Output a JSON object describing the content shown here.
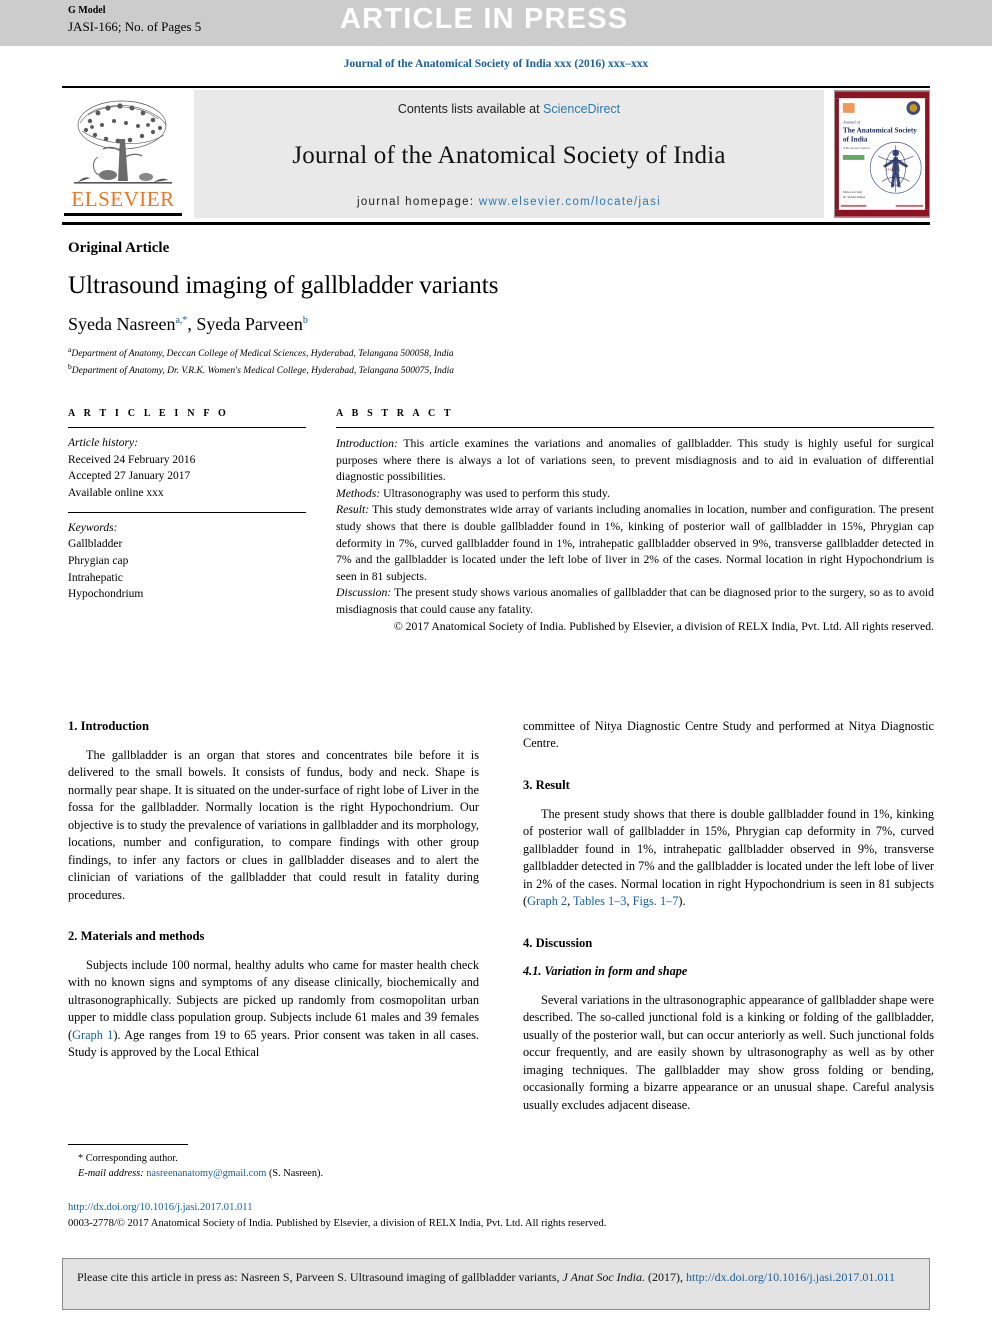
{
  "banner": {
    "press_text": "ARTICLE IN PRESS",
    "g_model": "G Model",
    "manuscript_id": "JASI-166; No. of Pages 5"
  },
  "running_head": "Journal of the Anatomical Society of India xxx (2016) xxx–xxx",
  "masthead": {
    "contents_prefix": "Contents lists available at ",
    "sciencedirect": "ScienceDirect",
    "journal_title": "Journal of the Anatomical Society of India",
    "homepage_prefix": "journal homepage: ",
    "homepage_url": "www.elsevier.com/locate/jasi",
    "publisher_wordmark": "ELSEVIER",
    "cover_title_line1": "The Anatomical Society",
    "cover_title_line2": "of India",
    "cover_journal_of": "Journal of"
  },
  "title_block": {
    "article_type": "Original Article",
    "title": "Ultrasound imaging of gallbladder variants",
    "author1": "Syeda Nasreen",
    "author1_sup": "a,*",
    "author_sep": ", ",
    "author2": "Syeda Parveen",
    "author2_sup": "b",
    "affiliation_a_marker": "a",
    "affiliation_a": "Department of Anatomy, Deccan College of Medical Sciences, Hyderabad, Telangana 500058, India",
    "affiliation_b_marker": "b",
    "affiliation_b": "Department of Anatomy, Dr. V.R.K. Women's Medical College, Hyderabad, Telangana 500075, India"
  },
  "article_info": {
    "heading": "A R T I C L E   I N F O",
    "history_label": "Article history:",
    "received": "Received 24 February 2016",
    "accepted": "Accepted 27 January 2017",
    "available": "Available online xxx",
    "keywords_label": "Keywords:",
    "keywords": [
      "Gallbladder",
      "Phrygian cap",
      "Intrahepatic",
      "Hypochondrium"
    ]
  },
  "abstract": {
    "heading": "A B S T R A C T",
    "introduction_label": "Introduction:",
    "introduction_text": " This article examines the variations and anomalies of gallbladder. This study is highly useful for surgical purposes where there is always a lot of variations seen, to prevent misdiagnosis and to aid in evaluation of differential diagnostic possibilities.",
    "methods_label": "Methods:",
    "methods_text": " Ultrasonography was used to perform this study.",
    "result_label": "Result:",
    "result_text": " This study demonstrates wide array of variants including anomalies in location, number and configuration. The present study shows that there is double gallbladder found in 1%, kinking of posterior wall of gallbladder in 15%, Phrygian cap deformity in 7%, curved gallbladder found in 1%, intrahepatic gallbladder observed in 9%, transverse gallbladder detected in 7% and the gallbladder is located under the left lobe of liver in 2% of the cases. Normal location in right Hypochondrium is seen in 81 subjects.",
    "discussion_label": "Discussion:",
    "discussion_text": " The present study shows various anomalies of gallbladder that can be diagnosed prior to the surgery, so as to avoid misdiagnosis that could cause any fatality.",
    "copyright": "© 2017 Anatomical Society of India. Published by Elsevier, a division of RELX India, Pvt. Ltd. All rights reserved."
  },
  "sections": {
    "introduction_heading": "1. Introduction",
    "introduction_para": "The gallbladder is an organ that stores and concentrates bile before it is delivered to the small bowels. It consists of fundus, body and neck. Shape is normally pear shape. It is situated on the under-surface of right lobe of Liver in the fossa for the gallbladder. Normally location is the right Hypochondrium. Our objective is to study the prevalence of variations in gallbladder and its morphology, locations, number and configuration, to compare findings with other group findings, to infer any factors or clues in gallbladder diseases and to alert the clinician of variations of the gallbladder that could result in fatality during procedures.",
    "methods_heading": "2. Materials and methods",
    "methods_para_part1": "Subjects include 100 normal, healthy adults who came for master health check with no known signs and symptoms of any disease clinically, biochemically and ultrasonographically. Subjects are picked up randomly from cosmopolitan urban upper to middle class population group. Subjects include 61 males and 39 females (",
    "methods_link1": "Graph 1",
    "methods_para_part2": "). Age ranges from 19 to 65 years. Prior consent was taken in all cases. Study is approved by the Local Ethical",
    "methods_continuation": "committee of Nitya Diagnostic Centre Study and performed at Nitya Diagnostic Centre.",
    "result_heading": "3. Result",
    "result_para_part1": "The present study shows that there is double gallbladder found in 1%, kinking of posterior wall of gallbladder in 15%, Phrygian cap deformity in 7%, curved gallbladder found in 1%, intrahepatic gallbladder observed in 9%, transverse gallbladder detected in 7% and the gallbladder is located under the left lobe of liver in 2% of the cases. Normal location in right Hypochondrium is seen in 81 subjects (",
    "result_link1": "Graph 2",
    "result_sep1": ", ",
    "result_link2": "Tables 1–3",
    "result_sep2": ", ",
    "result_link3": "Figs. 1–7",
    "result_para_part2": ").",
    "discussion_heading": "4. Discussion",
    "discussion_sub_heading": "4.1. Variation in form and shape",
    "discussion_para": "Several variations in the ultrasonographic appearance of gallbladder shape were described. The so-called junctional fold is a kinking or folding of the gallbladder, usually of the posterior wall, but can occur anteriorly as well. Such junctional folds occur frequently, and are easily shown by ultrasonography as well as by other imaging techniques. The gallbladder may show gross folding or bending, occasionally forming a bizarre appearance or an unusual shape. Careful analysis usually excludes adjacent disease."
  },
  "footnote": {
    "corresponding_marker": "*",
    "corresponding_label": " Corresponding author.",
    "email_label": "E-mail address:",
    "email": "nasreenanatomy@gmail.com",
    "email_suffix": " (S. Nasreen)."
  },
  "doi_block": {
    "doi_url": "http://dx.doi.org/10.1016/j.jasi.2017.01.011",
    "issn_line": "0003-2778/© 2017 Anatomical Society of India. Published by Elsevier, a division of RELX India, Pvt. Ltd. All rights reserved."
  },
  "citation_footer": {
    "prefix": "Please cite this article in press as: Nasreen  S, Parveen  S. Ultrasound imaging of gallbladder variants, ",
    "journal_abbrev": "J Anat Soc India.",
    "year": " (2017), ",
    "url": "http://dx.doi.org/10.1016/j.jasi.2017.01.011"
  },
  "colors": {
    "link_blue": "#16609e",
    "sciencedirect_blue": "#2a7ab0",
    "elsevier_orange": "#e87722",
    "banner_gray": "#cccccc",
    "masthead_gray": "#e9e9e9",
    "cite_box_gray": "#e3e3e3",
    "cover_maroon": "#8a1422",
    "cover_navy": "#1d2b63"
  }
}
